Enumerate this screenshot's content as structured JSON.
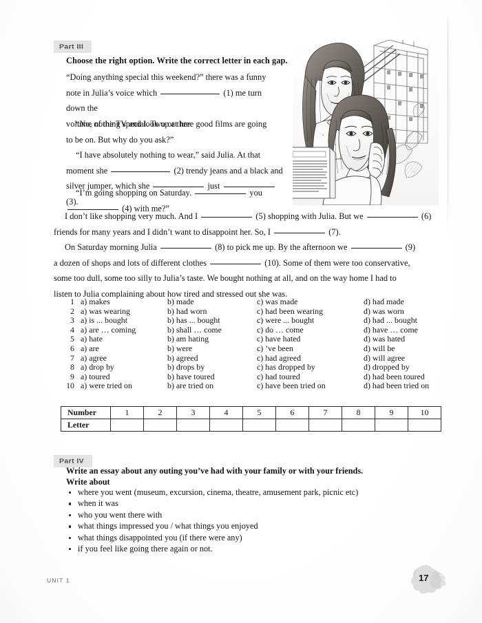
{
  "part3": {
    "badge": "Part III",
    "instruction": "Choose the right option. Write the correct letter in each gap.",
    "paragraphs": {
      "l1": "“Doing anything special this weekend?” there was a funny",
      "l2a": "note in Julia’s voice which",
      "l2b": "(1) me turn down the",
      "l3": "volume of the TV and look up at her.",
      "l4": "“No, nothing special. Two or three good films are going",
      "l5": "to be on. But why do you ask?”",
      "l6": "“I have absolutely nothing to wear,” said Julia. At that",
      "l7a": "moment she",
      "l7b": "(2) trendy jeans and a black and",
      "l8a": "silver jumper, which she",
      "l8b": "just",
      "l8c": "(3).",
      "l9a": "“I’m going shopping on Saturday.",
      "l9b": "you",
      "l10b": "(4) with me?”",
      "l11a": "I don’t like shopping very much. And I",
      "l11b": "(5) shopping with Julia. But we",
      "l11c": "(6)",
      "l12a": "friends for many years and I didn’t want to disappoint her. So, I",
      "l12b": "(7).",
      "l13a": "On Saturday morning Julia",
      "l13b": "(8) to pick me up. By the afternoon we",
      "l13c": "(9)",
      "l14a": "a dozen of shops and lots of different clothes",
      "l14b": "(10). Some of them were too conservative,",
      "l15": "some too dull, some too silly to Julia’s taste. We bought nothing at all, and on the way home I had to",
      "l16": "listen to Julia complaining about how tired and stressed out she was."
    },
    "options": [
      {
        "n": "1",
        "a": "a) makes",
        "b": "b) made",
        "c": "c) was made",
        "d": "d) had made"
      },
      {
        "n": "2",
        "a": "a) was wearing",
        "b": "b) had worn",
        "c": "c) had been wearing",
        "d": "d) was worn"
      },
      {
        "n": "3",
        "a": "a) is ... bought",
        "b": "b) has ... bought",
        "c": "c) were ... bought",
        "d": "d) had ... bought"
      },
      {
        "n": "4",
        "a": "a) are … coming",
        "b": "b) shall … come",
        "c": "c) do … come",
        "d": "d) have … come"
      },
      {
        "n": "5",
        "a": "a) hate",
        "b": "b) am hating",
        "c": "c) have hated",
        "d": "d) was hated"
      },
      {
        "n": "6",
        "a": "a) are",
        "b": "b) were",
        "c": "c) ’ve been",
        "d": "d) will be"
      },
      {
        "n": "7",
        "a": "a) agree",
        "b": "b) agreed",
        "c": "c) had agreed",
        "d": "d) will agree"
      },
      {
        "n": "8",
        "a": "a) drop by",
        "b": "b) drops by",
        "c": "c) has dropped by",
        "d": "d) dropped by"
      },
      {
        "n": "9",
        "a": "a) toured",
        "b": "b) have toured",
        "c": "c) had toured",
        "d": "d) had been toured"
      },
      {
        "n": "10",
        "a": "a) were tried on",
        "b": "b) are tried on",
        "c": "c) have been tried on",
        "d": "d) had been tried on"
      }
    ],
    "answer_table": {
      "row1_header": "Number",
      "row2_header": "Letter",
      "numbers": [
        "1",
        "2",
        "3",
        "4",
        "5",
        "6",
        "7",
        "8",
        "9",
        "10"
      ],
      "letters": [
        "",
        "",
        "",
        "",
        "",
        "",
        "",
        "",
        "",
        ""
      ]
    }
  },
  "part4": {
    "badge": "Part IV",
    "heading_line1": "Write an essay about any outing you’ve had with your family or with your friends.",
    "heading_line2": "Write about",
    "bullets": [
      "where you went (museum, excursion, cinema, theatre, amusement park, picnic etc)",
      "when it was",
      "who you went there with",
      "what things impressed you / what things you enjoyed",
      "what things disappointed you (if there were any)",
      "if you feel like going there again or not."
    ]
  },
  "footer": {
    "unit": "UNIT 1",
    "page_number": "17"
  },
  "illustration": {
    "caption": "pencil-sketch of two young women with a cityscape background"
  }
}
